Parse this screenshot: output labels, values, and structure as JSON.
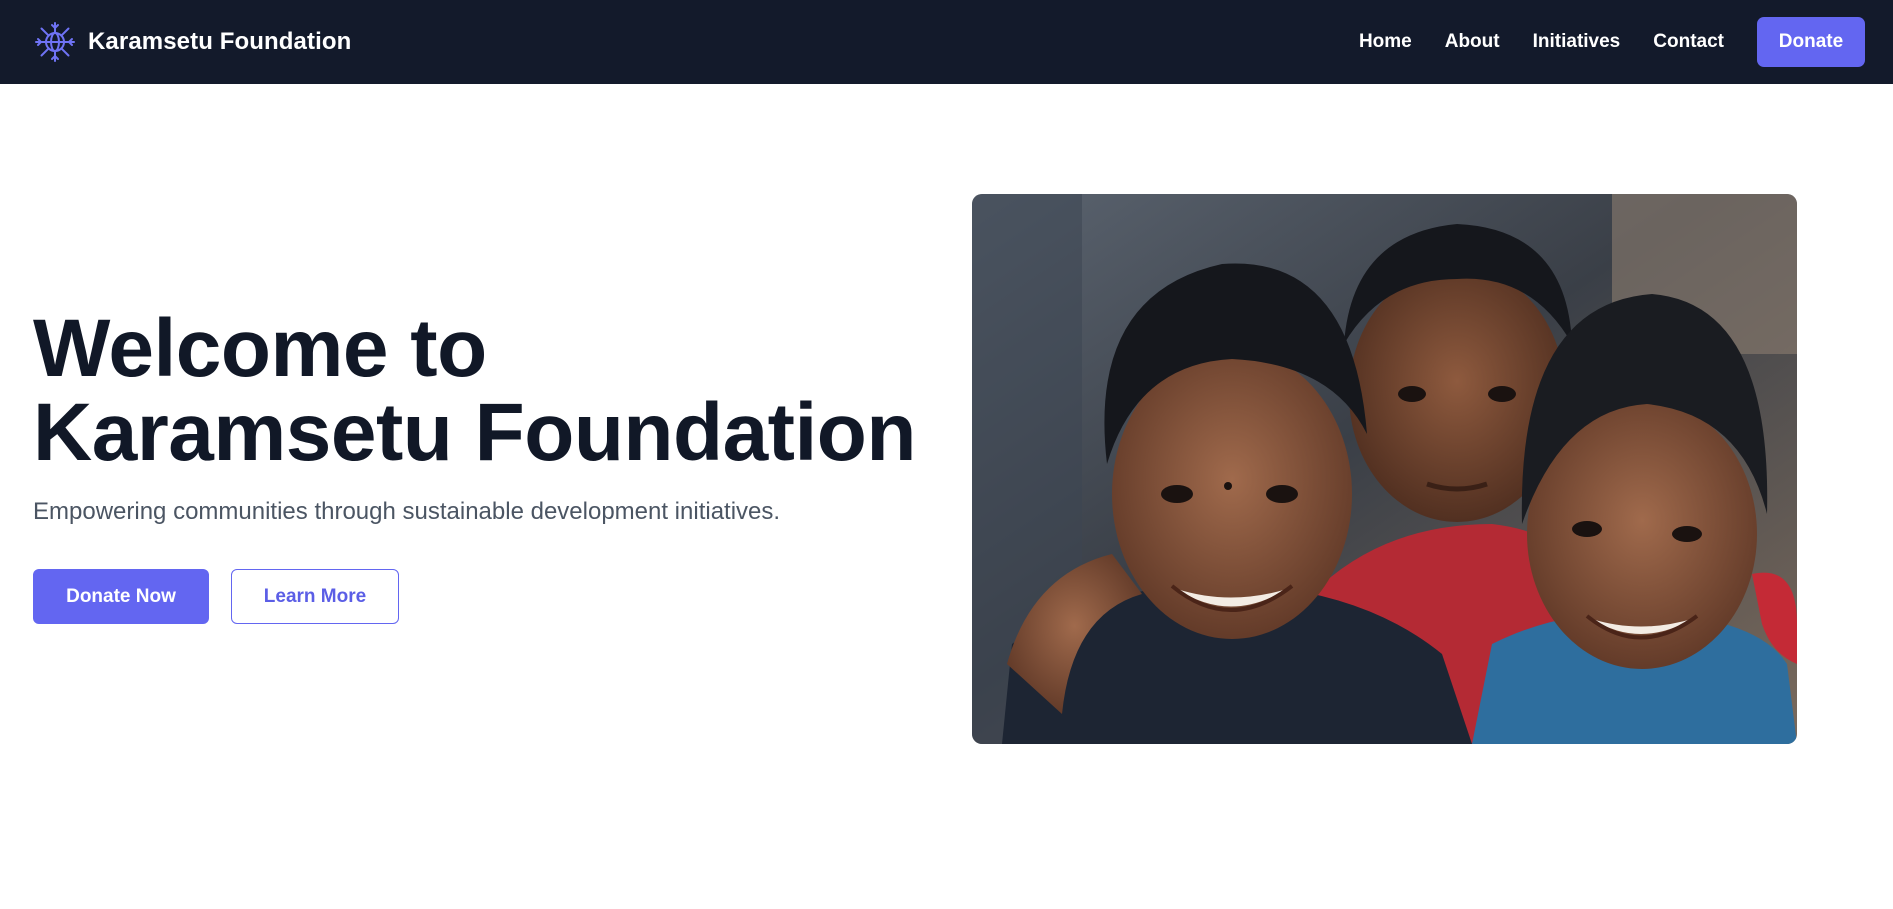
{
  "brand": {
    "name": "Karamsetu Foundation",
    "logo_icon": "globe-snowflake-icon"
  },
  "nav": {
    "links": [
      "Home",
      "About",
      "Initiatives",
      "Contact"
    ],
    "donate_label": "Donate"
  },
  "hero": {
    "title_line1": "Welcome to",
    "title_line2": "Karamsetu Foundation",
    "subtitle": "Empowering communities through sustainable development initiatives.",
    "primary_button": "Donate Now",
    "secondary_button": "Learn More",
    "image_icon": "children-photo"
  },
  "colors": {
    "nav_bg": "#131a2b",
    "accent": "#6366f1",
    "heading": "#111827",
    "subtext": "#4b5563"
  }
}
